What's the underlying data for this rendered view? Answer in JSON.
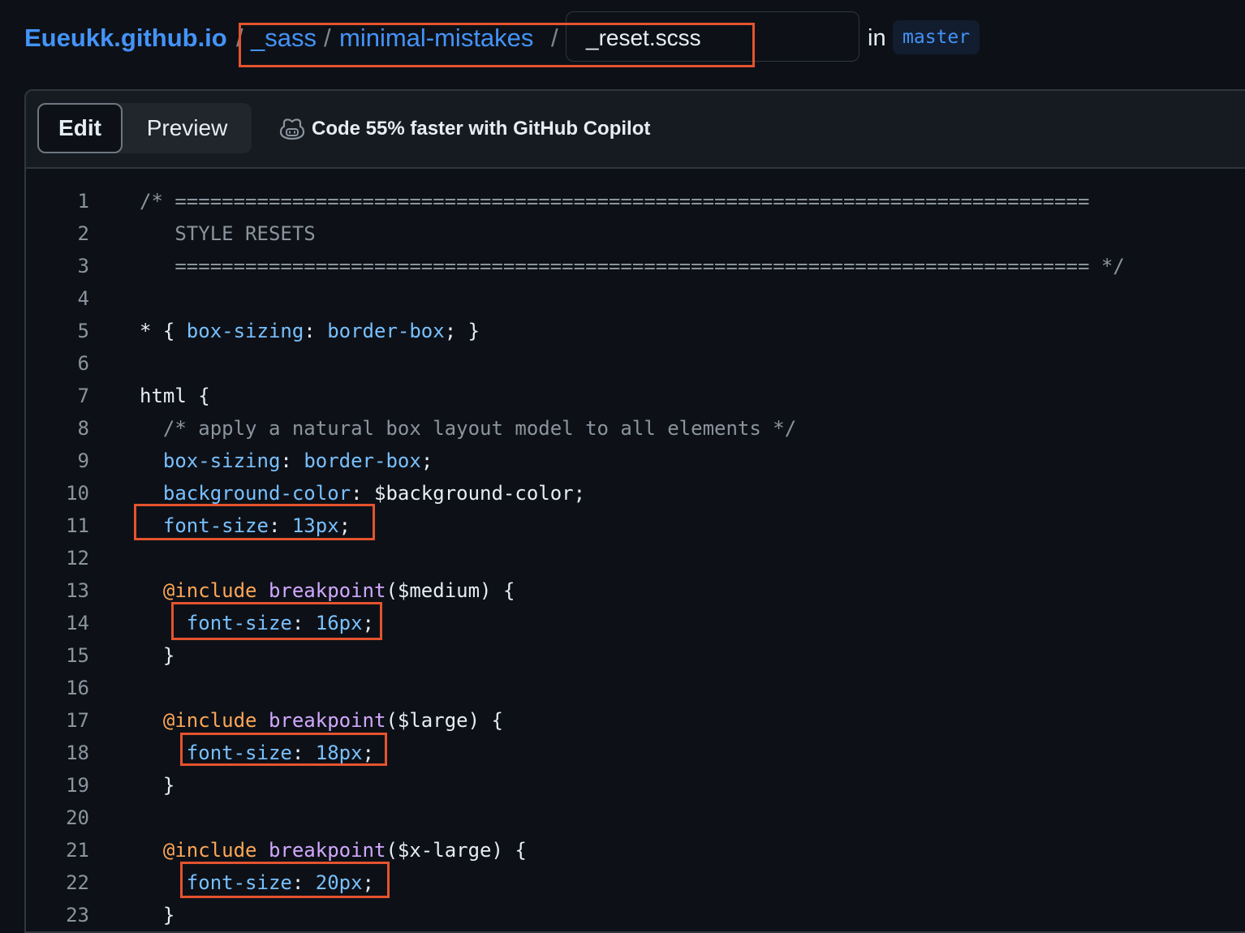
{
  "breadcrumb": {
    "repo": "Eueukk.github.io",
    "separator": "/",
    "folders": [
      "_sass",
      "minimal-mistakes"
    ],
    "filename": "_reset.scss",
    "in_label": "in",
    "branch": "master"
  },
  "toolbar": {
    "tabs": [
      {
        "label": "Edit",
        "active": true
      },
      {
        "label": "Preview",
        "active": false
      }
    ],
    "copilot_icon": "copilot-icon",
    "copilot_text": "Code 55% faster with GitHub Copilot"
  },
  "colors": {
    "background": "#0d1117",
    "link": "#4493f8",
    "comment": "#8b949e",
    "property": "#79c0ff",
    "keyword": "#ffa657",
    "function": "#d2a8ff",
    "highlight_box": "#e5532e"
  },
  "code": {
    "lines": [
      {
        "n": "1",
        "tokens": [
          [
            "c",
            "/* =============================================================================="
          ]
        ]
      },
      {
        "n": "2",
        "tokens": [
          [
            "c",
            "   STYLE RESETS"
          ]
        ]
      },
      {
        "n": "3",
        "tokens": [
          [
            "c",
            "   ============================================================================== */"
          ]
        ]
      },
      {
        "n": "4",
        "tokens": []
      },
      {
        "n": "5",
        "tokens": [
          [
            "t",
            "* { "
          ],
          [
            "p",
            "box-sizing"
          ],
          [
            "t",
            ": "
          ],
          [
            "p",
            "border-box"
          ],
          [
            "t",
            "; }"
          ]
        ]
      },
      {
        "n": "6",
        "tokens": []
      },
      {
        "n": "7",
        "tokens": [
          [
            "t",
            "html {"
          ]
        ]
      },
      {
        "n": "8",
        "tokens": [
          [
            "c",
            "  /* apply a natural box layout model to all elements */"
          ]
        ]
      },
      {
        "n": "9",
        "tokens": [
          [
            "t",
            "  "
          ],
          [
            "p",
            "box-sizing"
          ],
          [
            "t",
            ": "
          ],
          [
            "p",
            "border-box"
          ],
          [
            "t",
            ";"
          ]
        ]
      },
      {
        "n": "10",
        "tokens": [
          [
            "t",
            "  "
          ],
          [
            "p",
            "background-color"
          ],
          [
            "t",
            ": $background-color;"
          ]
        ]
      },
      {
        "n": "11",
        "tokens": [
          [
            "t",
            "  "
          ],
          [
            "p",
            "font-size"
          ],
          [
            "t",
            ": "
          ],
          [
            "p",
            "13px"
          ],
          [
            "t",
            ";"
          ]
        ]
      },
      {
        "n": "12",
        "tokens": []
      },
      {
        "n": "13",
        "tokens": [
          [
            "t",
            "  "
          ],
          [
            "k",
            "@include"
          ],
          [
            "t",
            " "
          ],
          [
            "f",
            "breakpoint"
          ],
          [
            "t",
            "($medium) {"
          ]
        ]
      },
      {
        "n": "14",
        "tokens": [
          [
            "t",
            "    "
          ],
          [
            "p",
            "font-size"
          ],
          [
            "t",
            ": "
          ],
          [
            "p",
            "16px"
          ],
          [
            "t",
            ";"
          ]
        ]
      },
      {
        "n": "15",
        "tokens": [
          [
            "t",
            "  }"
          ]
        ]
      },
      {
        "n": "16",
        "tokens": []
      },
      {
        "n": "17",
        "tokens": [
          [
            "t",
            "  "
          ],
          [
            "k",
            "@include"
          ],
          [
            "t",
            " "
          ],
          [
            "f",
            "breakpoint"
          ],
          [
            "t",
            "($large) {"
          ]
        ]
      },
      {
        "n": "18",
        "tokens": [
          [
            "t",
            "    "
          ],
          [
            "p",
            "font-size"
          ],
          [
            "t",
            ": "
          ],
          [
            "p",
            "18px"
          ],
          [
            "t",
            ";"
          ]
        ]
      },
      {
        "n": "19",
        "tokens": [
          [
            "t",
            "  }"
          ]
        ]
      },
      {
        "n": "20",
        "tokens": []
      },
      {
        "n": "21",
        "tokens": [
          [
            "t",
            "  "
          ],
          [
            "k",
            "@include"
          ],
          [
            "t",
            " "
          ],
          [
            "f",
            "breakpoint"
          ],
          [
            "t",
            "($x-large) {"
          ]
        ]
      },
      {
        "n": "22",
        "tokens": [
          [
            "t",
            "    "
          ],
          [
            "p",
            "font-size"
          ],
          [
            "t",
            ": "
          ],
          [
            "p",
            "20px"
          ],
          [
            "t",
            ";"
          ]
        ]
      },
      {
        "n": "23",
        "tokens": [
          [
            "t",
            "  }"
          ]
        ]
      }
    ]
  }
}
